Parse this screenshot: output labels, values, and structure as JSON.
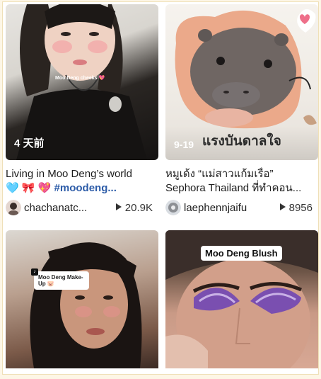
{
  "cards": [
    {
      "overlay_caption": "Moo Deng cheeks 💖",
      "time_badge": "4 天前",
      "title_line1": "Living in Moo Deng’s world",
      "title_line2_emoji": "🩵 🎀 💖 ",
      "title_line2_tag": "#moodeng...",
      "handle": "chachanatc...",
      "plays": "20.9K"
    },
    {
      "date_badge": "9-19",
      "banner_text": "แรงบันดาลใจ",
      "title_line1": "หมูเด้ง “แม่สาวแก้มเรื่อ”",
      "title_line2": "Sephora Thailand ที่ทำคอน...",
      "handle": "laephennjaifu",
      "plays": "8956"
    },
    {
      "sticker_text": "Moo Deng Make-Up 🐷",
      "tt_mark": "♪"
    },
    {
      "label": "Moo Deng Blush"
    }
  ],
  "colors": {
    "tag_blue": "#2d5ca8",
    "frame_border": "#efe0b8",
    "blush_pink": "#ee6f8a"
  },
  "icons": [
    "play-icon",
    "heart-icon"
  ]
}
